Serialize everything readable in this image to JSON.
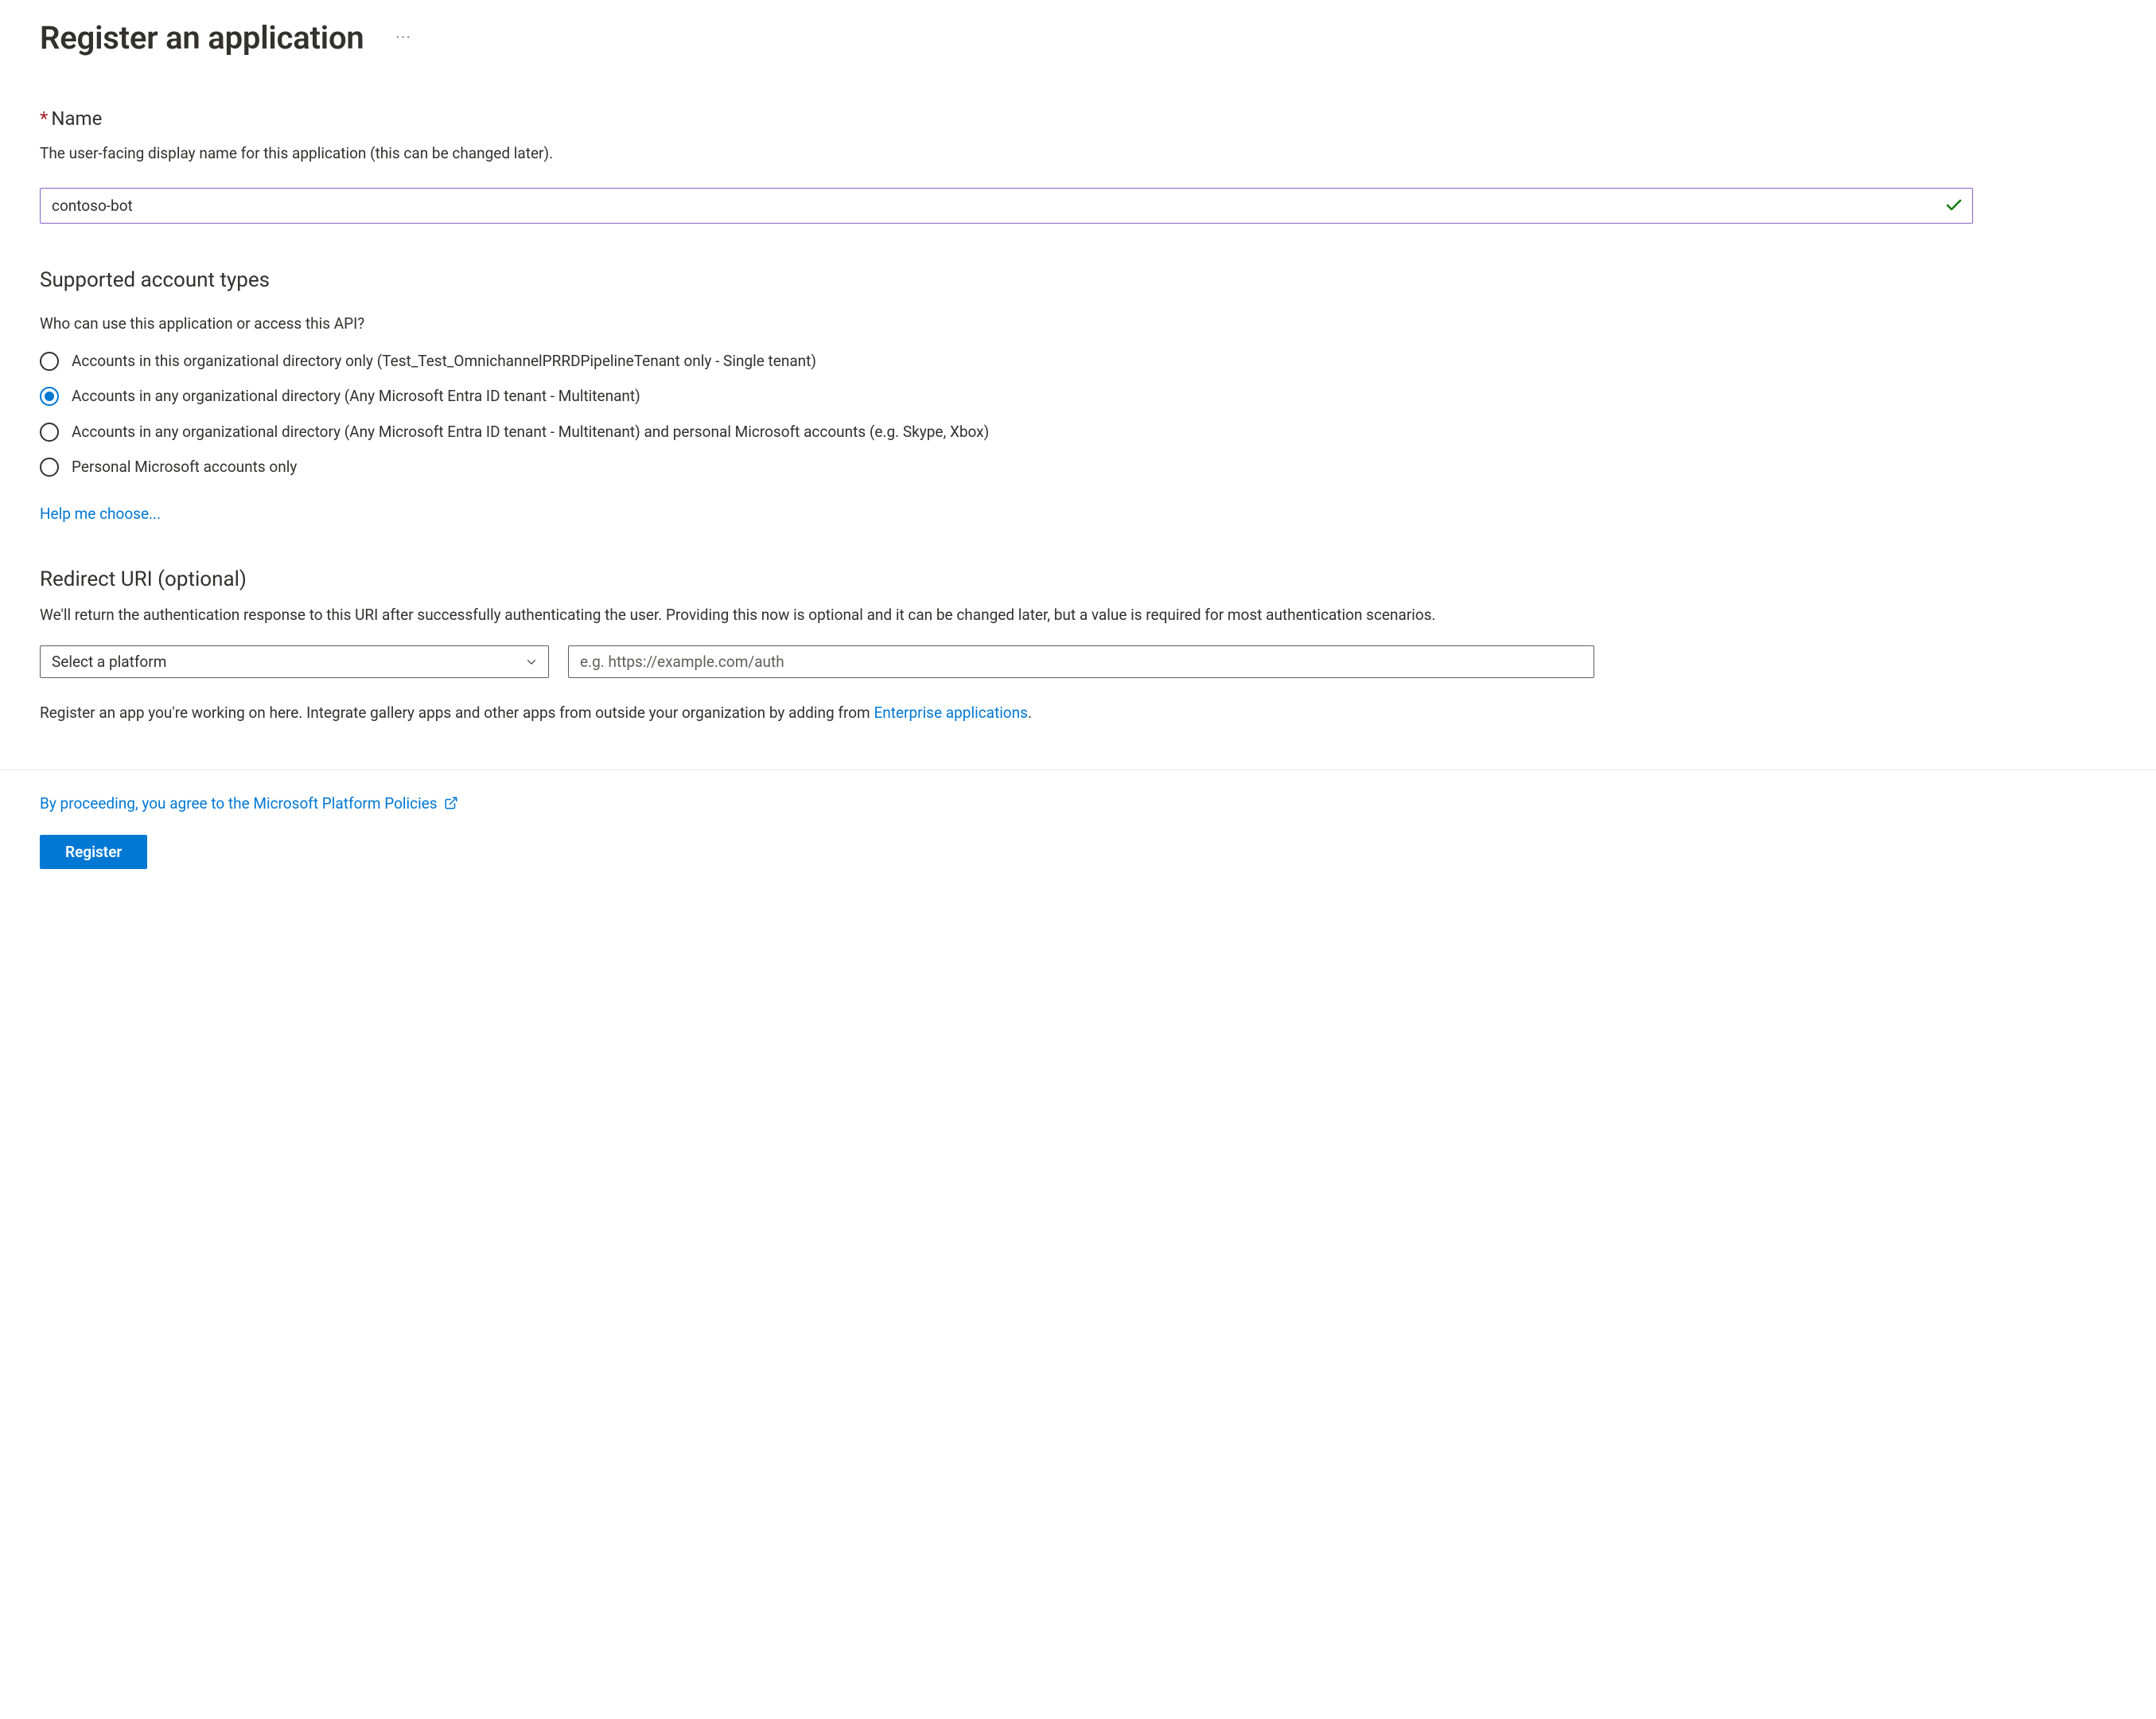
{
  "header": {
    "title": "Register an application"
  },
  "name_section": {
    "label": "Name",
    "description": "The user-facing display name for this application (this can be changed later).",
    "value": "contoso-bot"
  },
  "account_types": {
    "heading": "Supported account types",
    "question": "Who can use this application or access this API?",
    "options": [
      "Accounts in this organizational directory only (Test_Test_OmnichannelPRRDPipelineTenant only - Single tenant)",
      "Accounts in any organizational directory (Any Microsoft Entra ID tenant - Multitenant)",
      "Accounts in any organizational directory (Any Microsoft Entra ID tenant - Multitenant) and personal Microsoft accounts (e.g. Skype, Xbox)",
      "Personal Microsoft accounts only"
    ],
    "selected_index": 1,
    "help_link": "Help me choose..."
  },
  "redirect": {
    "heading": "Redirect URI (optional)",
    "description": "We'll return the authentication response to this URI after successfully authenticating the user. Providing this now is optional and it can be changed later, but a value is required for most authentication scenarios.",
    "platform_placeholder": "Select a platform",
    "uri_placeholder": "e.g. https://example.com/auth",
    "integrate_prefix": "Register an app you're working on here. Integrate gallery apps and other apps from outside your organization by adding from ",
    "integrate_link": "Enterprise applications",
    "integrate_suffix": "."
  },
  "footer": {
    "policies_text": "By proceeding, you agree to the Microsoft Platform Policies",
    "register_label": "Register"
  }
}
